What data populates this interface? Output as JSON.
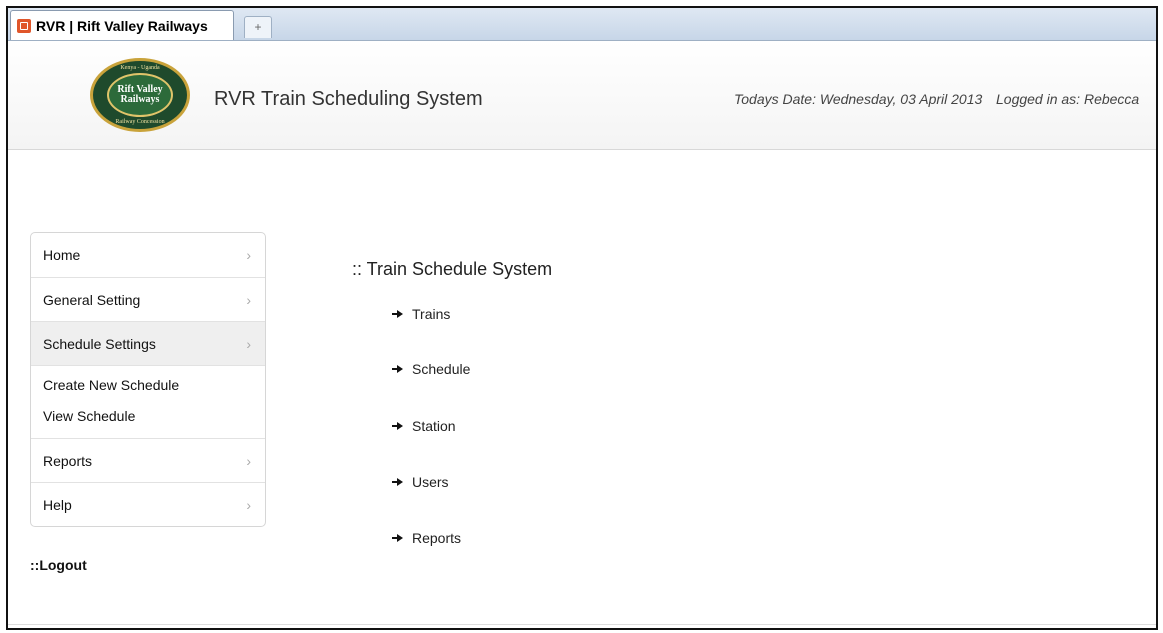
{
  "browser": {
    "tab_title": "RVR | Rift Valley Railways",
    "new_tab_symbol": "+"
  },
  "header": {
    "logo": {
      "top_text": "Kenya - Uganda",
      "line1": "Rift Valley",
      "line2": "Railways",
      "bottom_text": "Railway Concession"
    },
    "app_title": "RVR Train Scheduling System",
    "date_text": "Todays Date: Wednesday, 03 April 2013",
    "user_text": "Logged in as: Rebecca"
  },
  "sidebar": {
    "items": [
      {
        "label": "Home"
      },
      {
        "label": "General Setting"
      },
      {
        "label": "Schedule Settings"
      },
      {
        "label": "Reports"
      },
      {
        "label": "Help"
      }
    ],
    "sub_items": [
      {
        "label": "Create New Schedule"
      },
      {
        "label": "View Schedule"
      }
    ],
    "chevron": "›",
    "logout_label": "::Logout"
  },
  "main": {
    "title": ":: Train Schedule System",
    "links": [
      {
        "label": "Trains"
      },
      {
        "label": "Schedule"
      },
      {
        "label": "Station"
      },
      {
        "label": "Users"
      },
      {
        "label": "Reports"
      }
    ]
  },
  "colors": {
    "tab_icon": "#e0562b",
    "active_nav_bg": "#efefef",
    "logo_green": "#1f4a2c",
    "logo_gold": "#c9a33b"
  }
}
